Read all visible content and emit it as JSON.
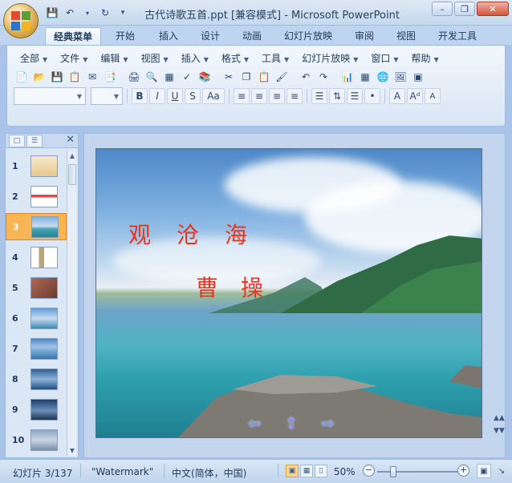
{
  "window": {
    "title": "古代诗歌五首.ppt [兼容模式] - Microsoft PowerPoint"
  },
  "tabs": [
    "经典菜单",
    "开始",
    "插入",
    "设计",
    "动画",
    "幻灯片放映",
    "审阅",
    "视图",
    "开发工具"
  ],
  "active_tab": "经典菜单",
  "menu": [
    {
      "label": "全部"
    },
    {
      "label": "文件"
    },
    {
      "label": "编辑"
    },
    {
      "label": "视图"
    },
    {
      "label": "插入"
    },
    {
      "label": "格式"
    },
    {
      "label": "工具"
    },
    {
      "label": "幻灯片放映"
    },
    {
      "label": "窗口"
    },
    {
      "label": "帮助"
    }
  ],
  "format_buttons": {
    "bold": "B",
    "italic": "I",
    "underline": "U",
    "strike": "S",
    "case": "Aa"
  },
  "slides": {
    "numbers": [
      "1",
      "2",
      "3",
      "4",
      "5",
      "6",
      "7",
      "8",
      "9",
      "10"
    ],
    "selected_index": 3
  },
  "slide_content": {
    "title": "观沧海",
    "author": "曹操"
  },
  "nav_icons": [
    "left-arrow-icon",
    "home-icon",
    "right-arrow-icon"
  ],
  "status": {
    "slide_info": "幻灯片 3/137",
    "theme": "\"Watermark\"",
    "language": "中文(简体，中国)",
    "zoom": "50%",
    "zoom_level": 0.5
  },
  "colors": {
    "title_red": "#e9351f",
    "ribbon_bg": "#dae6f5",
    "selected_slide": "#f7b553",
    "nav_arrow": "#6e8cff"
  }
}
